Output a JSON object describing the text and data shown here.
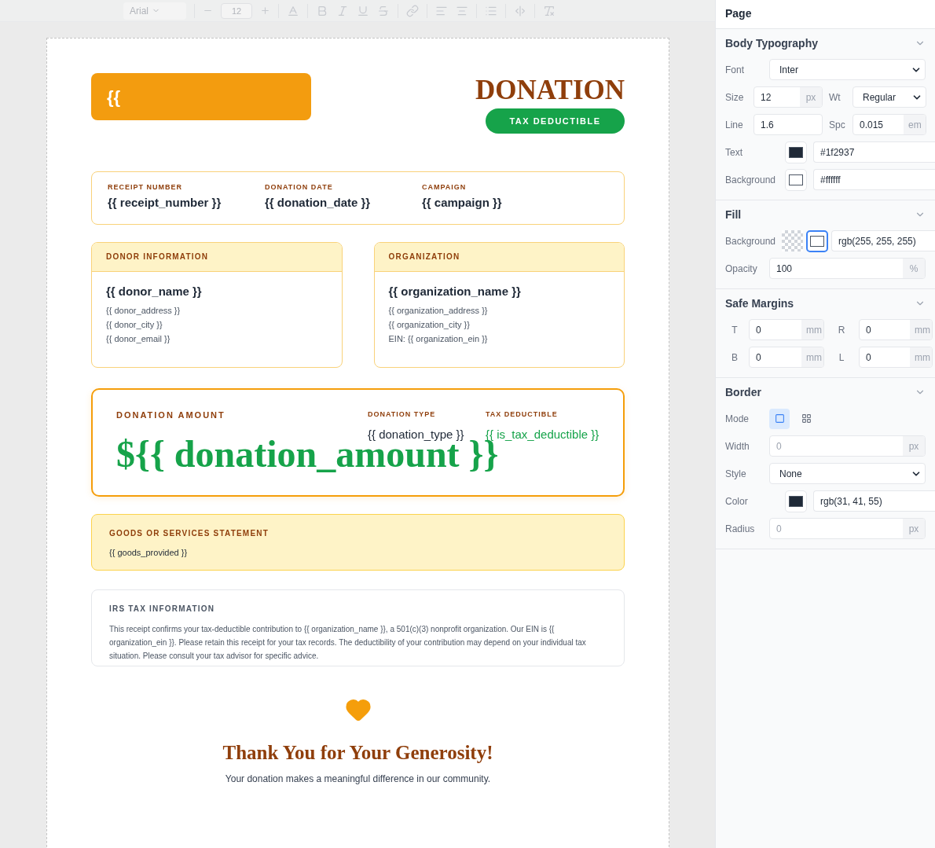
{
  "toolbar": {
    "disabled": true,
    "font": "Arial",
    "size": "12"
  },
  "receipt": {
    "logo_text": "{{",
    "title": "DONATION",
    "badge": "TAX DEDUCTIBLE",
    "meta": [
      {
        "label": "RECEIPT NUMBER",
        "value": "{{ receipt_number }}"
      },
      {
        "label": "DONATION DATE",
        "value": "{{ donation_date }}"
      },
      {
        "label": "CAMPAIGN",
        "value": "{{ campaign }}"
      }
    ],
    "parties": [
      {
        "title": "DONOR INFORMATION",
        "name": "{{ donor_name }}",
        "lines": [
          "{{ donor_address }}",
          "{{ donor_city }}",
          "{{ donor_email }}"
        ]
      },
      {
        "title": "ORGANIZATION",
        "name": "{{ organization_name }}",
        "lines": [
          "{{ organization_address }}",
          "{{ organization_city }}",
          "EIN: {{ organization_ein }}"
        ]
      }
    ],
    "amount": {
      "label": "DONATION AMOUNT",
      "value": "${{ donation_amount }}",
      "details": [
        {
          "label": "DONATION TYPE",
          "value": "{{ donation_type }}",
          "color": "#1f2937"
        },
        {
          "label": "TAX DEDUCTIBLE",
          "value": "{{ is_tax_deductible }}",
          "color": "#16a34a"
        }
      ]
    },
    "goods": {
      "title": "GOODS OR SERVICES STATEMENT",
      "text": "{{ goods_provided }}"
    },
    "irs": {
      "title": "IRS TAX INFORMATION",
      "text": "This receipt confirms your tax-deductible contribution to {{ organization_name }}, a 501(c)(3) nonprofit organization. Our EIN is {{ organization_ein }}. Please retain this receipt for your tax records. The deductibility of your contribution may depend on your individual tax situation. Please consult your tax advisor for specific advice."
    },
    "thanks": {
      "title": "Thank You for Your Generosity!",
      "text": "Your donation makes a meaningful difference in our community."
    }
  },
  "panel": {
    "title": "Page",
    "sections": [
      {
        "title": "Body Typography",
        "expanded": true,
        "rows": [
          {
            "kind": "select",
            "label": "Font",
            "value": "Inter"
          },
          {
            "kind": "pair",
            "fields": [
              {
                "kind": "unit",
                "label": "Size",
                "value": "12",
                "unit": "px"
              },
              {
                "kind": "select",
                "label": "Wt",
                "value": "Regular"
              }
            ]
          },
          {
            "kind": "pair",
            "fields": [
              {
                "kind": "text",
                "label": "Line",
                "value": "1.6"
              },
              {
                "kind": "unit",
                "label": "Spc",
                "value": "0.015",
                "unit": "em"
              }
            ]
          },
          {
            "kind": "color",
            "label": "Text",
            "color": "#1f2937",
            "value": "#1f2937"
          },
          {
            "kind": "color",
            "label": "Background",
            "color": "#ffffff",
            "value": "#ffffff"
          }
        ]
      },
      {
        "title": "Fill",
        "expanded": true,
        "rows": [
          {
            "kind": "fill",
            "label": "Background",
            "color": "#ffffff",
            "value": "rgb(255, 255, 255)"
          },
          {
            "kind": "unit",
            "label": "Opacity",
            "value": "100",
            "unit": "%"
          }
        ]
      },
      {
        "title": "Safe Margins",
        "expanded": true,
        "rows": [
          {
            "kind": "margins",
            "fields": [
              {
                "kind": "unit",
                "label": "T",
                "value": "0",
                "unit": "mm"
              },
              {
                "kind": "unit",
                "label": "R",
                "value": "0",
                "unit": "mm"
              }
            ]
          },
          {
            "kind": "margins",
            "fields": [
              {
                "kind": "unit",
                "label": "B",
                "value": "0",
                "unit": "mm"
              },
              {
                "kind": "unit",
                "label": "L",
                "value": "0",
                "unit": "mm"
              }
            ]
          }
        ]
      },
      {
        "title": "Border",
        "expanded": true,
        "rows": [
          {
            "kind": "mode",
            "label": "Mode",
            "options": [
              {
                "kind": "square",
                "selected": true
              },
              {
                "kind": "grid",
                "selected": false
              }
            ]
          },
          {
            "kind": "unit",
            "label": "Width",
            "placeholder": "0",
            "unit": "px"
          },
          {
            "kind": "select",
            "label": "Style",
            "value": "None"
          },
          {
            "kind": "color",
            "label": "Color",
            "color": "#1f2937",
            "value": "rgb(31, 41, 55)"
          },
          {
            "kind": "unit",
            "label": "Radius",
            "placeholder": "0",
            "unit": "px"
          }
        ]
      }
    ]
  }
}
